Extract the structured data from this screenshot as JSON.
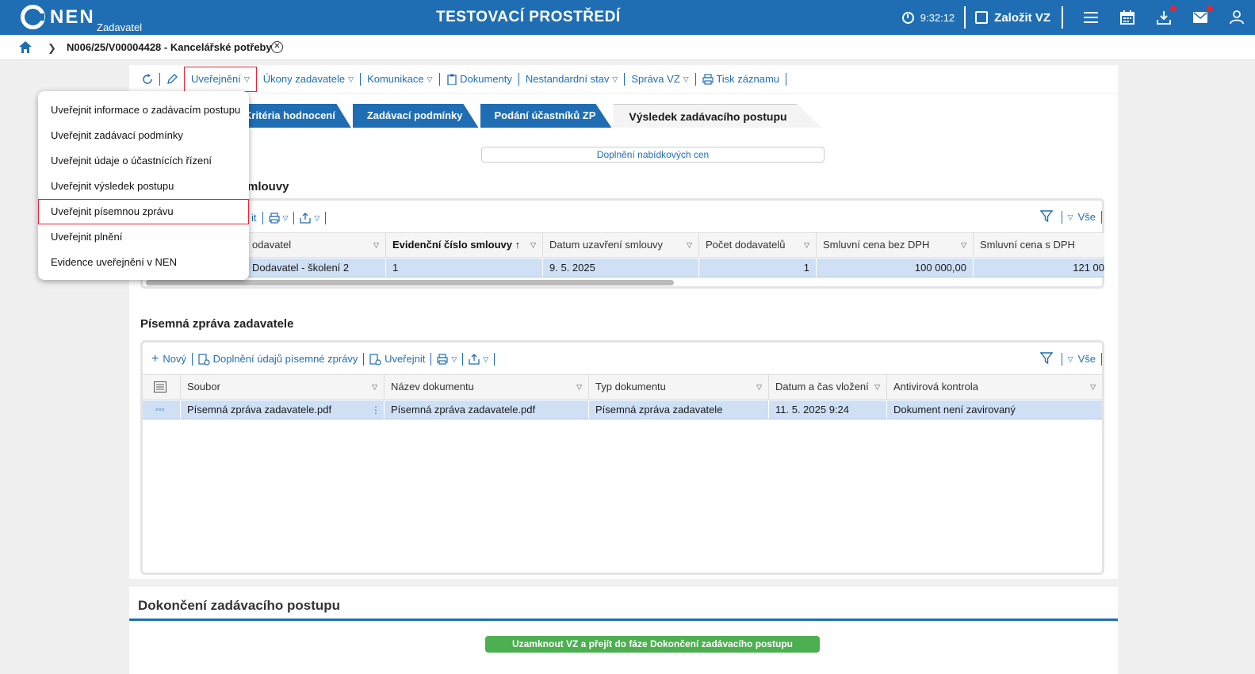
{
  "header": {
    "logo_text": "NEN",
    "logo_sub": "Zadavatel",
    "env_title": "TESTOVACÍ PROSTŘEDÍ",
    "time": "9:32:12",
    "create_label": "Založit VZ"
  },
  "breadcrumb": {
    "title": "N006/25/V00004428 - Kancelářské potřeby"
  },
  "toolbar": {
    "items": [
      "Uveřejnění",
      "Úkony zadavatele",
      "Komunikace",
      "Dokumenty",
      "Nestandardní stav",
      "Správa VZ",
      "Tisk záznamu"
    ]
  },
  "tabs": [
    "Kritéria hodnocení",
    "Zadávací podmínky",
    "Podání účastníků ZP",
    "Výsledek zadávacího postupu"
  ],
  "doplneni_label": "Doplnění nabídkových cen",
  "contracts": {
    "title_partial": "mlouvy",
    "tool_partial": "it",
    "all_label": "Vše",
    "columns": [
      "odavatel",
      "Evidenční číslo smlouvy",
      "Datum uzavření smlouvy",
      "Počet dodavatelů",
      "Smluvní cena bez DPH",
      "Smluvní cena s DPH"
    ],
    "row": [
      "Dodavatel - školení 2",
      "1",
      "9. 5. 2025",
      "1",
      "100 000,00",
      "121 00"
    ]
  },
  "report": {
    "title": "Písemná zpráva zadavatele",
    "tools": [
      "Nový",
      "Doplnění údajů písemné zprávy",
      "Uveřejnit"
    ],
    "all_label": "Vše",
    "columns": [
      "Soubor",
      "Název dokumentu",
      "Typ dokumentu",
      "Datum a čas vložení",
      "Antivirová kontrola"
    ],
    "row": [
      "Písemná zpráva zadavatele.pdf",
      "Písemná zpráva zadavatele.pdf",
      "Písemná zpráva zadavatele",
      "11. 5. 2025 9:24",
      "Dokument není zavirovaný"
    ]
  },
  "dropdown": {
    "items": [
      "Uveřejnit informace o zadávacím postupu",
      "Uveřejnit zadávací podmínky",
      "Uveřejnit údaje o účastnících řízení",
      "Uveřejnit výsledek postupu",
      "Uveřejnit písemnou zprávu",
      "Uveřejnit plnění",
      "Evidence uveřejnění v NEN"
    ],
    "selected_index": 4
  },
  "completion": {
    "title": "Dokončení zadávacího postupu",
    "button": "Uzamknout VZ a přejít do fáze Dokončení zadávacího postupu"
  },
  "colors": {
    "brand": "#1f6eb3",
    "alert": "#e32636",
    "success": "#4caf50",
    "selected_row": "#cfe0f5"
  }
}
